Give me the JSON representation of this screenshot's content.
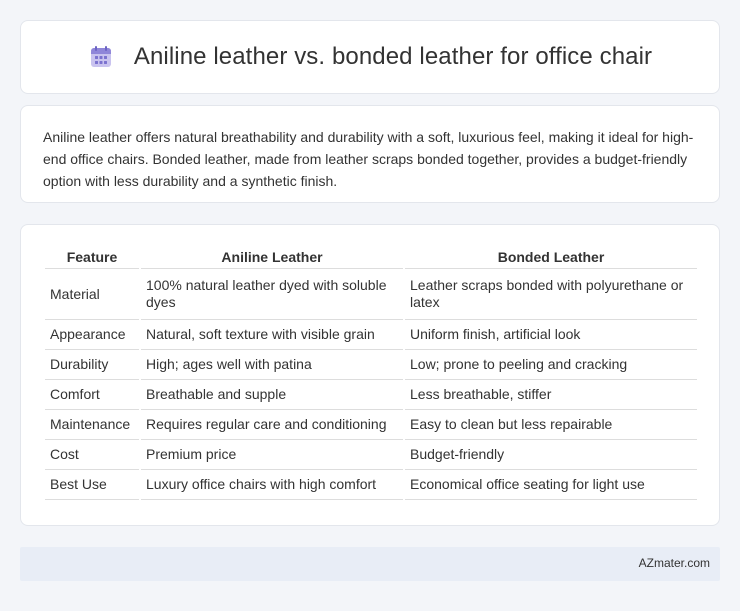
{
  "header": {
    "title": "Aniline leather vs. bonded leather for office chair",
    "icon": "calendar-icon"
  },
  "summary": {
    "text": "Aniline leather offers natural breathability and durability with a soft, luxurious feel, making it ideal for high-end office chairs. Bonded leather, made from leather scraps bonded together, provides a budget-friendly option with less durability and a synthetic finish."
  },
  "table": {
    "headers": [
      "Feature",
      "Aniline Leather",
      "Bonded Leather"
    ],
    "rows": [
      [
        "Material",
        "100% natural leather dyed with soluble dyes",
        "Leather scraps bonded with polyurethane or latex"
      ],
      [
        "Appearance",
        "Natural, soft texture with visible grain",
        "Uniform finish, artificial look"
      ],
      [
        "Durability",
        "High; ages well with patina",
        "Low; prone to peeling and cracking"
      ],
      [
        "Comfort",
        "Breathable and supple",
        "Less breathable, stiffer"
      ],
      [
        "Maintenance",
        "Requires regular care and conditioning",
        "Easy to clean but less repairable"
      ],
      [
        "Cost",
        "Premium price",
        "Budget-friendly"
      ],
      [
        "Best Use",
        "Luxury office chairs with high comfort",
        "Economical office seating for light use"
      ]
    ]
  },
  "footer": {
    "brand": "AZmater.com"
  }
}
